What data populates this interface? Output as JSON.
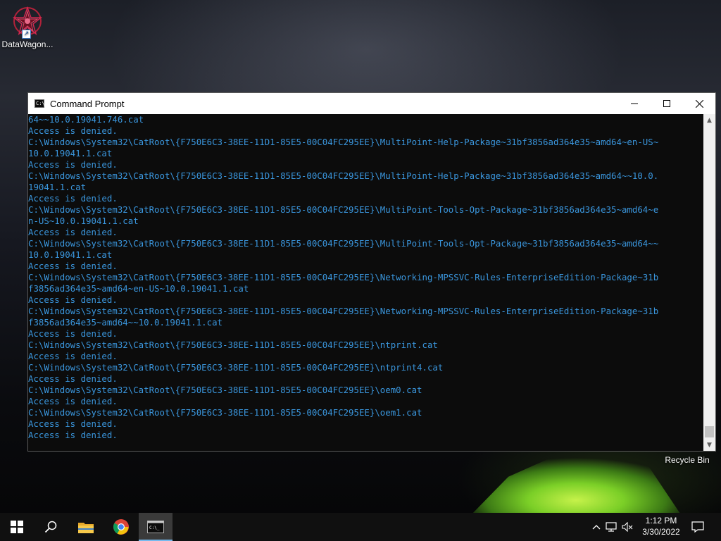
{
  "desktop": {
    "icons": [
      {
        "label": "DataWagon..."
      },
      {
        "label": "Recycle Bin"
      }
    ]
  },
  "window": {
    "title": "Command Prompt",
    "console_lines": [
      "64~~10.0.19041.746.cat",
      "Access is denied.",
      "C:\\Windows\\System32\\CatRoot\\{F750E6C3-38EE-11D1-85E5-00C04FC295EE}\\MultiPoint-Help-Package~31bf3856ad364e35~amd64~en-US~",
      "10.0.19041.1.cat",
      "Access is denied.",
      "C:\\Windows\\System32\\CatRoot\\{F750E6C3-38EE-11D1-85E5-00C04FC295EE}\\MultiPoint-Help-Package~31bf3856ad364e35~amd64~~10.0.",
      "19041.1.cat",
      "Access is denied.",
      "C:\\Windows\\System32\\CatRoot\\{F750E6C3-38EE-11D1-85E5-00C04FC295EE}\\MultiPoint-Tools-Opt-Package~31bf3856ad364e35~amd64~e",
      "n-US~10.0.19041.1.cat",
      "Access is denied.",
      "C:\\Windows\\System32\\CatRoot\\{F750E6C3-38EE-11D1-85E5-00C04FC295EE}\\MultiPoint-Tools-Opt-Package~31bf3856ad364e35~amd64~~",
      "10.0.19041.1.cat",
      "Access is denied.",
      "C:\\Windows\\System32\\CatRoot\\{F750E6C3-38EE-11D1-85E5-00C04FC295EE}\\Networking-MPSSVC-Rules-EnterpriseEdition-Package~31b",
      "f3856ad364e35~amd64~en-US~10.0.19041.1.cat",
      "Access is denied.",
      "C:\\Windows\\System32\\CatRoot\\{F750E6C3-38EE-11D1-85E5-00C04FC295EE}\\Networking-MPSSVC-Rules-EnterpriseEdition-Package~31b",
      "f3856ad364e35~amd64~~10.0.19041.1.cat",
      "Access is denied.",
      "C:\\Windows\\System32\\CatRoot\\{F750E6C3-38EE-11D1-85E5-00C04FC295EE}\\ntprint.cat",
      "Access is denied.",
      "C:\\Windows\\System32\\CatRoot\\{F750E6C3-38EE-11D1-85E5-00C04FC295EE}\\ntprint4.cat",
      "Access is denied.",
      "C:\\Windows\\System32\\CatRoot\\{F750E6C3-38EE-11D1-85E5-00C04FC295EE}\\oem0.cat",
      "Access is denied.",
      "C:\\Windows\\System32\\CatRoot\\{F750E6C3-38EE-11D1-85E5-00C04FC295EE}\\oem1.cat",
      "Access is denied.",
      "Access is denied."
    ],
    "text_color": "#3a96dd",
    "background_color": "#0c0c0c"
  },
  "taskbar": {
    "items": [
      "windows-start-icon",
      "search-icon",
      "file-explorer-icon",
      "chrome-icon",
      "command-prompt-icon"
    ],
    "tray_icons": [
      "chevron-up-icon",
      "network-icon",
      "volume-muted-icon"
    ],
    "clock": {
      "time": "1:12 PM",
      "date": "3/30/2022"
    },
    "notification_icon": "notification-icon"
  }
}
